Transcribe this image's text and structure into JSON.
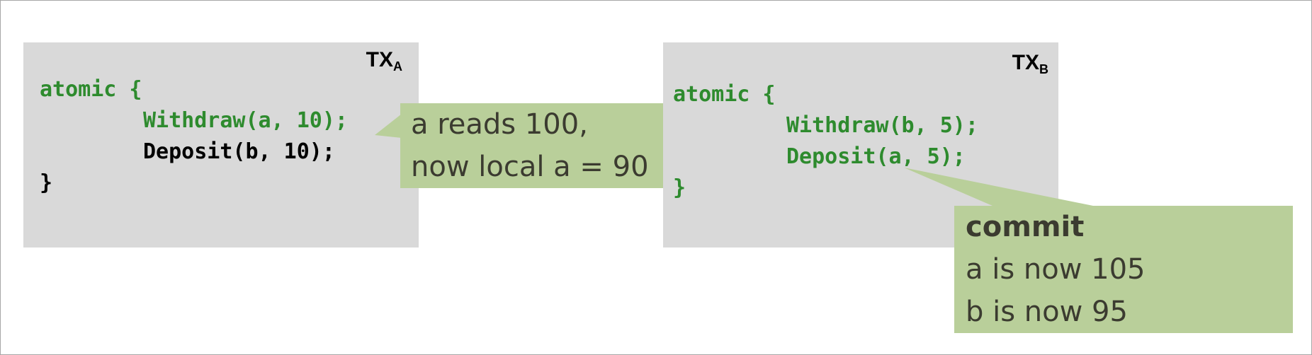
{
  "colors": {
    "panel": "#d9d9d9",
    "callout": "#b9cf9a",
    "code_green": "#2e8b2e",
    "code_black": "#000000",
    "callout_text": "#3b3b30"
  },
  "tx_a": {
    "label_main": "TX",
    "label_sub": "A",
    "lines": [
      "atomic {",
      "Withdraw(a, 10);",
      "Deposit(b, 10);",
      "}"
    ]
  },
  "tx_b": {
    "label_main": "TX",
    "label_sub": "B",
    "lines": [
      "atomic {",
      "Withdraw(b, 5);",
      "Deposit(a, 5);",
      "}"
    ]
  },
  "callout_a": {
    "line1": "a reads 100,",
    "line2": "now local a = 90"
  },
  "callout_b": {
    "title": "commit",
    "line1": "a is now 105",
    "line2": "b is now 95"
  }
}
